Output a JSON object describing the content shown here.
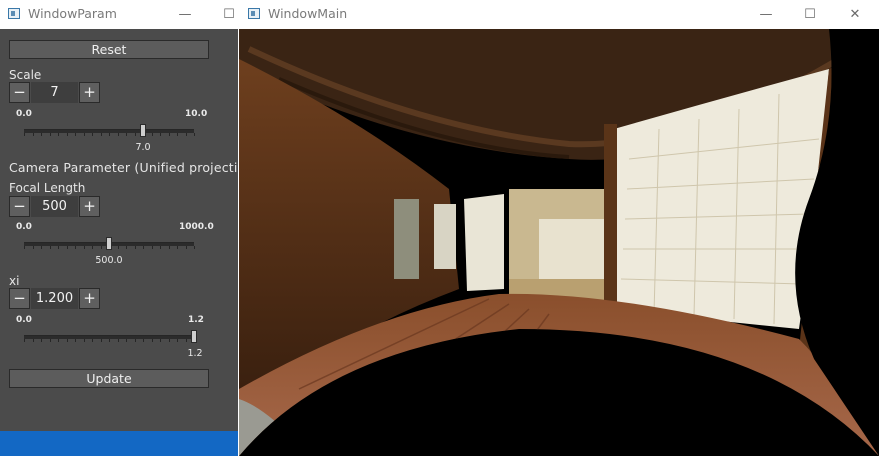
{
  "param_window": {
    "title": "WindowParam",
    "reset_label": "Reset",
    "update_label": "Update",
    "scale": {
      "label": "Scale",
      "value": "7",
      "min": "0.0",
      "max": "10.0",
      "current": "7.0",
      "fraction": 0.7
    },
    "section_label": "Camera Parameter (Unified projection",
    "focal": {
      "label": "Focal Length",
      "value": "500",
      "min": "0.0",
      "max": "1000.0",
      "current": "500.0",
      "fraction": 0.5
    },
    "xi": {
      "label": "xi",
      "value": "1.200",
      "min": "0.0",
      "max": "1.2",
      "current": "1.2",
      "fraction": 1.0
    },
    "controls": {
      "minus": "−",
      "plus": "+",
      "minimize": "—",
      "maximize": "☐"
    }
  },
  "main_window": {
    "title": "WindowMain",
    "controls": {
      "minimize": "—",
      "maximize": "☐",
      "close": "✕"
    },
    "image": {
      "description_icon": "undistorted-room-image"
    }
  }
}
